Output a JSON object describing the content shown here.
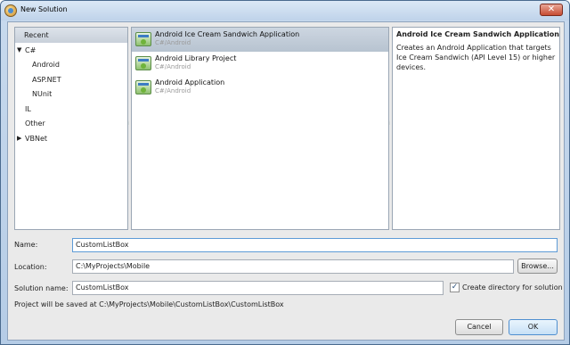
{
  "window": {
    "title": "New Solution"
  },
  "categories": {
    "header": "Recent",
    "items": [
      {
        "label": "C#",
        "expander": "▼"
      },
      {
        "label": "Android"
      },
      {
        "label": "ASP.NET"
      },
      {
        "label": "NUnit"
      },
      {
        "label": "IL"
      },
      {
        "label": "Other"
      },
      {
        "label": "VBNet",
        "expander": "▶"
      }
    ]
  },
  "templates": [
    {
      "name": "Android Ice Cream Sandwich Application",
      "language": "C#/Android"
    },
    {
      "name": "Android Library Project",
      "language": "C#/Android"
    },
    {
      "name": "Android Application",
      "language": "C#/Android"
    }
  ],
  "description": {
    "title": "Android Ice Cream Sandwich Application",
    "text": "Creates an Android Application that targets Ice Cream Sandwich (API Level 15) or higher devices."
  },
  "form": {
    "name_label": "Name:",
    "name_value": "CustomListBox",
    "location_label": "Location:",
    "location_value": "C:\\MyProjects\\Mobile",
    "browse_label": "Browse...",
    "solution_label": "Solution name:",
    "solution_value": "CustomListBox",
    "create_dir_label": "Create directory for solution",
    "create_dir_checked": true,
    "save_path": "Project will be saved at C:\\MyProjects\\Mobile\\CustomListBox\\CustomListBox"
  },
  "buttons": {
    "cancel": "Cancel",
    "ok": "OK"
  },
  "colors": {
    "selection": "#c2ccd8",
    "title_bar": "#c8daee",
    "focus_border": "#5e9bd6"
  }
}
